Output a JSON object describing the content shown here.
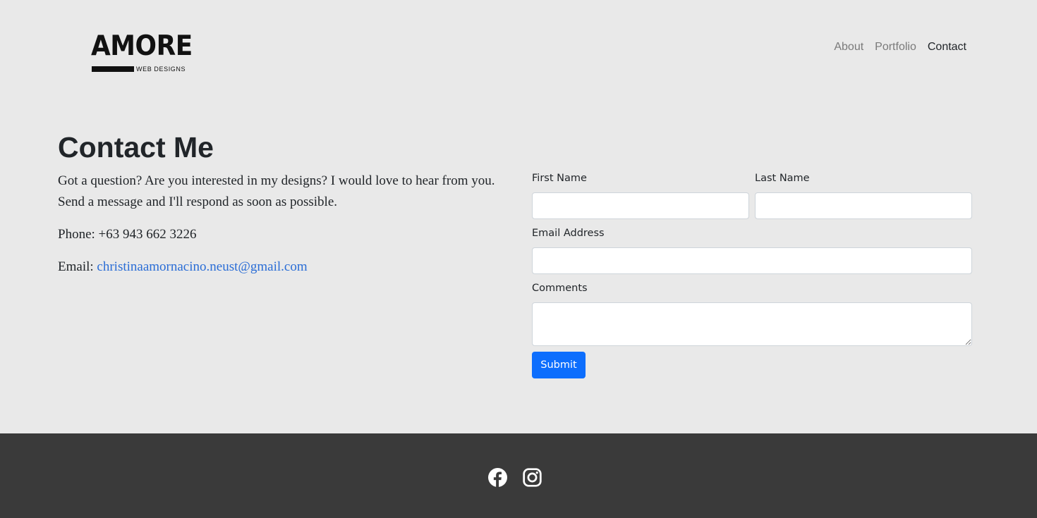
{
  "brand": {
    "name": "AMORE",
    "tagline": "WEB DESIGNS"
  },
  "nav": {
    "items": [
      {
        "label": "About",
        "active": false
      },
      {
        "label": "Portfolio",
        "active": false
      },
      {
        "label": "Contact",
        "active": true
      }
    ]
  },
  "contact": {
    "title": "Contact Me",
    "intro": "Got a question? Are you interested in my designs? I would love to hear from you. Send a message and I'll respond as soon as possible.",
    "phone_label": "Phone:",
    "phone": "+63 943 662 3226",
    "email_label": "Email:",
    "email": "christinaamornacino.neust@gmail.com"
  },
  "form": {
    "first_name_label": "First Name",
    "first_name_value": "",
    "last_name_label": "Last Name",
    "last_name_value": "",
    "email_label": "Email Address",
    "email_value": "",
    "comments_label": "Comments",
    "comments_value": "",
    "submit_label": "Submit"
  },
  "footer": {
    "social": [
      {
        "name": "facebook-icon"
      },
      {
        "name": "instagram-icon"
      }
    ]
  },
  "colors": {
    "background": "#e9e9e9",
    "footer": "#3a3a3a",
    "primary": "#0d6efd",
    "link": "#2a6dd6"
  }
}
